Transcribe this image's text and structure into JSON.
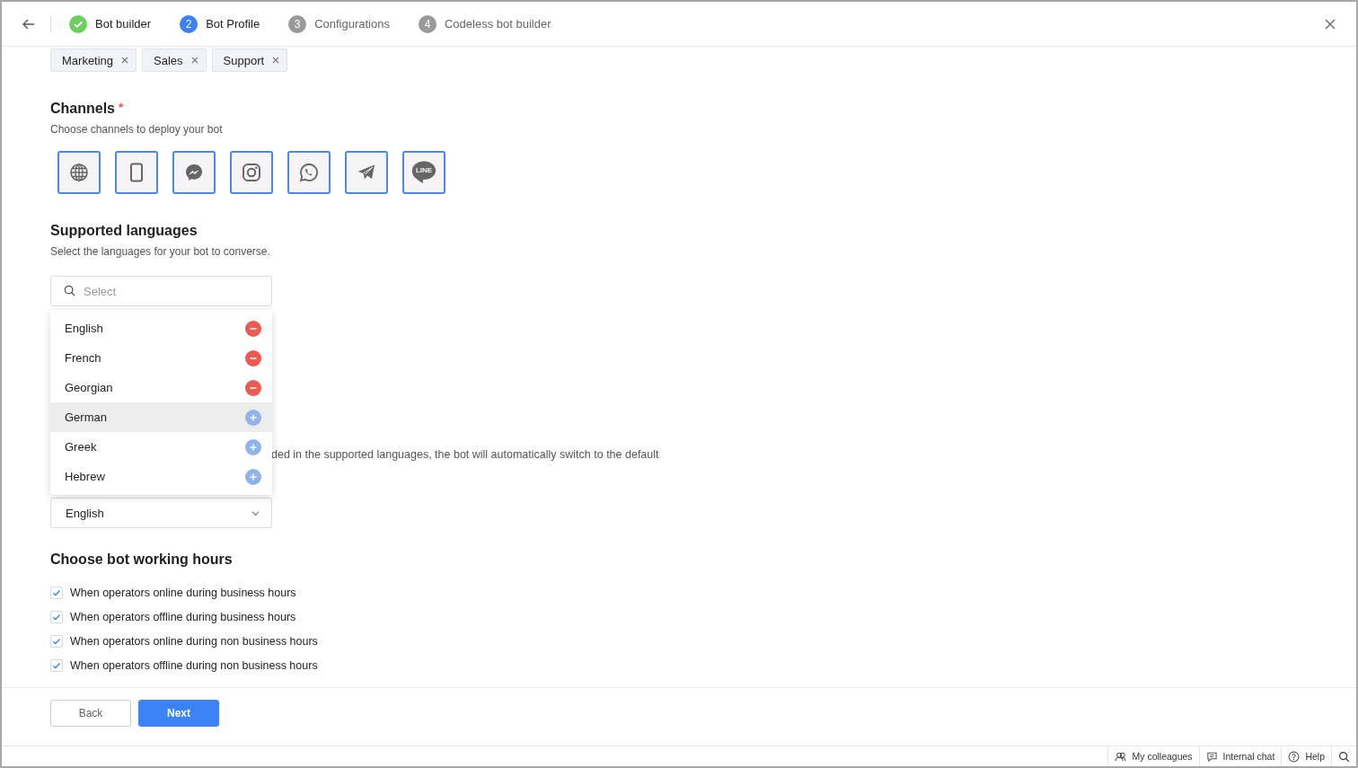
{
  "steps": [
    {
      "label": "Bot builder",
      "done": true,
      "selected": false
    },
    {
      "number": "2",
      "label": "Bot Profile",
      "done": false,
      "selected": true
    },
    {
      "number": "3",
      "label": "Configurations",
      "done": false,
      "selected": false
    },
    {
      "number": "4",
      "label": "Codeless bot builder",
      "done": false,
      "selected": false
    }
  ],
  "tags": [
    "Marketing",
    "Sales",
    "Support"
  ],
  "channels": {
    "title": "Channels",
    "required_mark": "*",
    "subtitle": "Choose channels to deploy your bot",
    "items": [
      {
        "kind": "web",
        "selected": true
      },
      {
        "kind": "mobile",
        "selected": true
      },
      {
        "kind": "messenger",
        "selected": true
      },
      {
        "kind": "instagram",
        "selected": true
      },
      {
        "kind": "whatsapp",
        "selected": true
      },
      {
        "kind": "telegram",
        "selected": true
      },
      {
        "kind": "line",
        "selected": true,
        "logo_text": "LINE"
      }
    ]
  },
  "languages": {
    "title": "Supported languages",
    "subtitle": "Select the languages for your bot to converse.",
    "placeholder": "Select",
    "options": [
      {
        "label": "English",
        "added": true,
        "highlighted": false
      },
      {
        "label": "French",
        "added": true,
        "highlighted": false
      },
      {
        "label": "Georgian",
        "added": true,
        "highlighted": false
      },
      {
        "label": "German",
        "added": false,
        "highlighted": true
      },
      {
        "label": "Greek",
        "added": false,
        "highlighted": false
      },
      {
        "label": "Hebrew",
        "added": false,
        "highlighted": false
      }
    ],
    "note": "ded in the supported languages, the bot will automatically switch to the default",
    "default_value": "English"
  },
  "working_hours": {
    "title": "Choose bot working hours",
    "options": [
      {
        "label": "When operators online during business hours",
        "checked": true
      },
      {
        "label": "When operators offline during business hours",
        "checked": true
      },
      {
        "label": "When operators online during non business hours",
        "checked": true
      },
      {
        "label": "When operators offline during non business hours",
        "checked": true
      }
    ]
  },
  "buttons": {
    "back": "Back",
    "next": "Next"
  },
  "footer": [
    {
      "kind": "colleagues",
      "label": "My colleagues"
    },
    {
      "kind": "chat",
      "label": "Internal chat"
    },
    {
      "kind": "help",
      "label": "Help"
    },
    {
      "kind": "search"
    }
  ]
}
